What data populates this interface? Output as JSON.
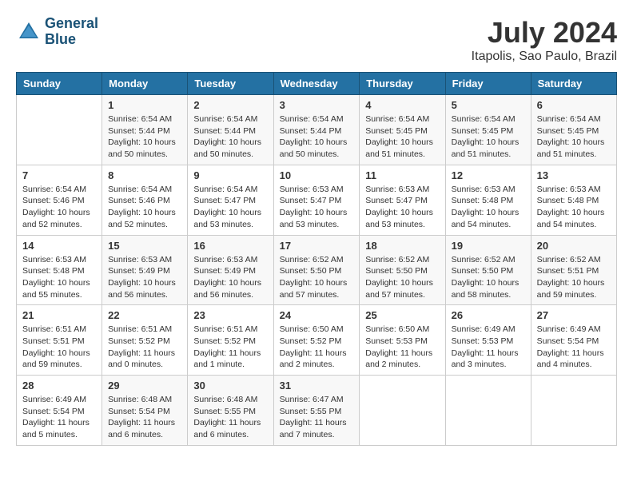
{
  "header": {
    "logo_line1": "General",
    "logo_line2": "Blue",
    "month_year": "July 2024",
    "location": "Itapolis, Sao Paulo, Brazil"
  },
  "columns": [
    "Sunday",
    "Monday",
    "Tuesday",
    "Wednesday",
    "Thursday",
    "Friday",
    "Saturday"
  ],
  "weeks": [
    [
      {
        "num": "",
        "sunrise": "",
        "sunset": "",
        "daylight": ""
      },
      {
        "num": "1",
        "sunrise": "Sunrise: 6:54 AM",
        "sunset": "Sunset: 5:44 PM",
        "daylight": "Daylight: 10 hours and 50 minutes."
      },
      {
        "num": "2",
        "sunrise": "Sunrise: 6:54 AM",
        "sunset": "Sunset: 5:44 PM",
        "daylight": "Daylight: 10 hours and 50 minutes."
      },
      {
        "num": "3",
        "sunrise": "Sunrise: 6:54 AM",
        "sunset": "Sunset: 5:44 PM",
        "daylight": "Daylight: 10 hours and 50 minutes."
      },
      {
        "num": "4",
        "sunrise": "Sunrise: 6:54 AM",
        "sunset": "Sunset: 5:45 PM",
        "daylight": "Daylight: 10 hours and 51 minutes."
      },
      {
        "num": "5",
        "sunrise": "Sunrise: 6:54 AM",
        "sunset": "Sunset: 5:45 PM",
        "daylight": "Daylight: 10 hours and 51 minutes."
      },
      {
        "num": "6",
        "sunrise": "Sunrise: 6:54 AM",
        "sunset": "Sunset: 5:45 PM",
        "daylight": "Daylight: 10 hours and 51 minutes."
      }
    ],
    [
      {
        "num": "7",
        "sunrise": "Sunrise: 6:54 AM",
        "sunset": "Sunset: 5:46 PM",
        "daylight": "Daylight: 10 hours and 52 minutes."
      },
      {
        "num": "8",
        "sunrise": "Sunrise: 6:54 AM",
        "sunset": "Sunset: 5:46 PM",
        "daylight": "Daylight: 10 hours and 52 minutes."
      },
      {
        "num": "9",
        "sunrise": "Sunrise: 6:54 AM",
        "sunset": "Sunset: 5:47 PM",
        "daylight": "Daylight: 10 hours and 53 minutes."
      },
      {
        "num": "10",
        "sunrise": "Sunrise: 6:53 AM",
        "sunset": "Sunset: 5:47 PM",
        "daylight": "Daylight: 10 hours and 53 minutes."
      },
      {
        "num": "11",
        "sunrise": "Sunrise: 6:53 AM",
        "sunset": "Sunset: 5:47 PM",
        "daylight": "Daylight: 10 hours and 53 minutes."
      },
      {
        "num": "12",
        "sunrise": "Sunrise: 6:53 AM",
        "sunset": "Sunset: 5:48 PM",
        "daylight": "Daylight: 10 hours and 54 minutes."
      },
      {
        "num": "13",
        "sunrise": "Sunrise: 6:53 AM",
        "sunset": "Sunset: 5:48 PM",
        "daylight": "Daylight: 10 hours and 54 minutes."
      }
    ],
    [
      {
        "num": "14",
        "sunrise": "Sunrise: 6:53 AM",
        "sunset": "Sunset: 5:48 PM",
        "daylight": "Daylight: 10 hours and 55 minutes."
      },
      {
        "num": "15",
        "sunrise": "Sunrise: 6:53 AM",
        "sunset": "Sunset: 5:49 PM",
        "daylight": "Daylight: 10 hours and 56 minutes."
      },
      {
        "num": "16",
        "sunrise": "Sunrise: 6:53 AM",
        "sunset": "Sunset: 5:49 PM",
        "daylight": "Daylight: 10 hours and 56 minutes."
      },
      {
        "num": "17",
        "sunrise": "Sunrise: 6:52 AM",
        "sunset": "Sunset: 5:50 PM",
        "daylight": "Daylight: 10 hours and 57 minutes."
      },
      {
        "num": "18",
        "sunrise": "Sunrise: 6:52 AM",
        "sunset": "Sunset: 5:50 PM",
        "daylight": "Daylight: 10 hours and 57 minutes."
      },
      {
        "num": "19",
        "sunrise": "Sunrise: 6:52 AM",
        "sunset": "Sunset: 5:50 PM",
        "daylight": "Daylight: 10 hours and 58 minutes."
      },
      {
        "num": "20",
        "sunrise": "Sunrise: 6:52 AM",
        "sunset": "Sunset: 5:51 PM",
        "daylight": "Daylight: 10 hours and 59 minutes."
      }
    ],
    [
      {
        "num": "21",
        "sunrise": "Sunrise: 6:51 AM",
        "sunset": "Sunset: 5:51 PM",
        "daylight": "Daylight: 10 hours and 59 minutes."
      },
      {
        "num": "22",
        "sunrise": "Sunrise: 6:51 AM",
        "sunset": "Sunset: 5:52 PM",
        "daylight": "Daylight: 11 hours and 0 minutes."
      },
      {
        "num": "23",
        "sunrise": "Sunrise: 6:51 AM",
        "sunset": "Sunset: 5:52 PM",
        "daylight": "Daylight: 11 hours and 1 minute."
      },
      {
        "num": "24",
        "sunrise": "Sunrise: 6:50 AM",
        "sunset": "Sunset: 5:52 PM",
        "daylight": "Daylight: 11 hours and 2 minutes."
      },
      {
        "num": "25",
        "sunrise": "Sunrise: 6:50 AM",
        "sunset": "Sunset: 5:53 PM",
        "daylight": "Daylight: 11 hours and 2 minutes."
      },
      {
        "num": "26",
        "sunrise": "Sunrise: 6:49 AM",
        "sunset": "Sunset: 5:53 PM",
        "daylight": "Daylight: 11 hours and 3 minutes."
      },
      {
        "num": "27",
        "sunrise": "Sunrise: 6:49 AM",
        "sunset": "Sunset: 5:54 PM",
        "daylight": "Daylight: 11 hours and 4 minutes."
      }
    ],
    [
      {
        "num": "28",
        "sunrise": "Sunrise: 6:49 AM",
        "sunset": "Sunset: 5:54 PM",
        "daylight": "Daylight: 11 hours and 5 minutes."
      },
      {
        "num": "29",
        "sunrise": "Sunrise: 6:48 AM",
        "sunset": "Sunset: 5:54 PM",
        "daylight": "Daylight: 11 hours and 6 minutes."
      },
      {
        "num": "30",
        "sunrise": "Sunrise: 6:48 AM",
        "sunset": "Sunset: 5:55 PM",
        "daylight": "Daylight: 11 hours and 6 minutes."
      },
      {
        "num": "31",
        "sunrise": "Sunrise: 6:47 AM",
        "sunset": "Sunset: 5:55 PM",
        "daylight": "Daylight: 11 hours and 7 minutes."
      },
      {
        "num": "",
        "sunrise": "",
        "sunset": "",
        "daylight": ""
      },
      {
        "num": "",
        "sunrise": "",
        "sunset": "",
        "daylight": ""
      },
      {
        "num": "",
        "sunrise": "",
        "sunset": "",
        "daylight": ""
      }
    ]
  ]
}
